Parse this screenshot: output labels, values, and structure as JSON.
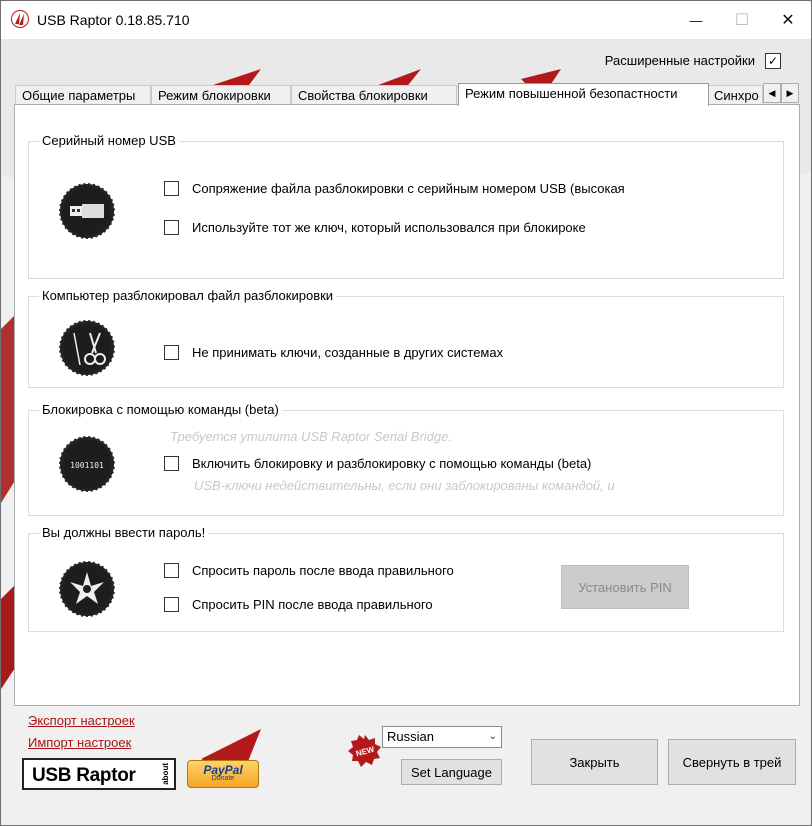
{
  "window": {
    "title": "USB Raptor 0.18.85.710",
    "minimize_glyph": "—",
    "maximize_glyph": "☐",
    "close_glyph": "✕"
  },
  "advanced": {
    "label": "Расширенные настройки",
    "checked": true,
    "check_glyph": "✓"
  },
  "tabs": [
    {
      "label": "Общие параметры"
    },
    {
      "label": "Режим блокировки"
    },
    {
      "label": "Свойства блокировки"
    },
    {
      "label": "Режим повышенной безопастности",
      "active": true
    },
    {
      "label": "Синхро"
    }
  ],
  "tab_scroll": {
    "left": "◀",
    "right": "▶"
  },
  "groups": {
    "serial": {
      "title": "Серийный номер USB",
      "icon": "usb-drive-icon",
      "options": [
        {
          "label": "Сопряжение файла разблокировки с серийным номером USB (высокая",
          "checked": false
        },
        {
          "label": "Используйте тот же ключ, который использовался при блокироке",
          "checked": false
        }
      ]
    },
    "computer": {
      "title": "Компьютер разблокировал файл разблокировки",
      "icon": "scissors-icon",
      "options": [
        {
          "label": "Не принимать ключи, созданные в других системах",
          "checked": false
        }
      ]
    },
    "command": {
      "title": "Блокировка с помощью команды (beta)",
      "icon": "binary-icon",
      "icon_text": "1001101",
      "hint_top": "Требуется утилита USB Raptor Serial Bridge.",
      "option": {
        "label": "Включить блокировку и разблокировку с помощью команды (beta)",
        "checked": false
      },
      "hint_bottom": "USB-ключи недействительны, если они заблокированы командой, и"
    },
    "password": {
      "title": "Вы должны ввести пароль!",
      "icon": "raptor-icon",
      "options": [
        {
          "label": "Спросить пароль после ввода правильного",
          "checked": false
        },
        {
          "label": "Спросить PIN после ввода правильного",
          "checked": false
        }
      ],
      "set_pin_label": "Установить PIN"
    }
  },
  "footer": {
    "export_link": "Экспорт настроек",
    "import_link": "Импорт настроек",
    "logo_text": "USB Raptor",
    "logo_about": "about",
    "paypal_text": "PayPal",
    "paypal_sub": "Donate",
    "new_badge": "NEW",
    "language_value": "Russian",
    "set_language_label": "Set Language",
    "close_label": "Закрыть",
    "tray_label": "Свернуть в трей"
  },
  "colors": {
    "link": "#a81616",
    "accent_red": "#b3191b",
    "disabled_button": "#cccccc"
  }
}
